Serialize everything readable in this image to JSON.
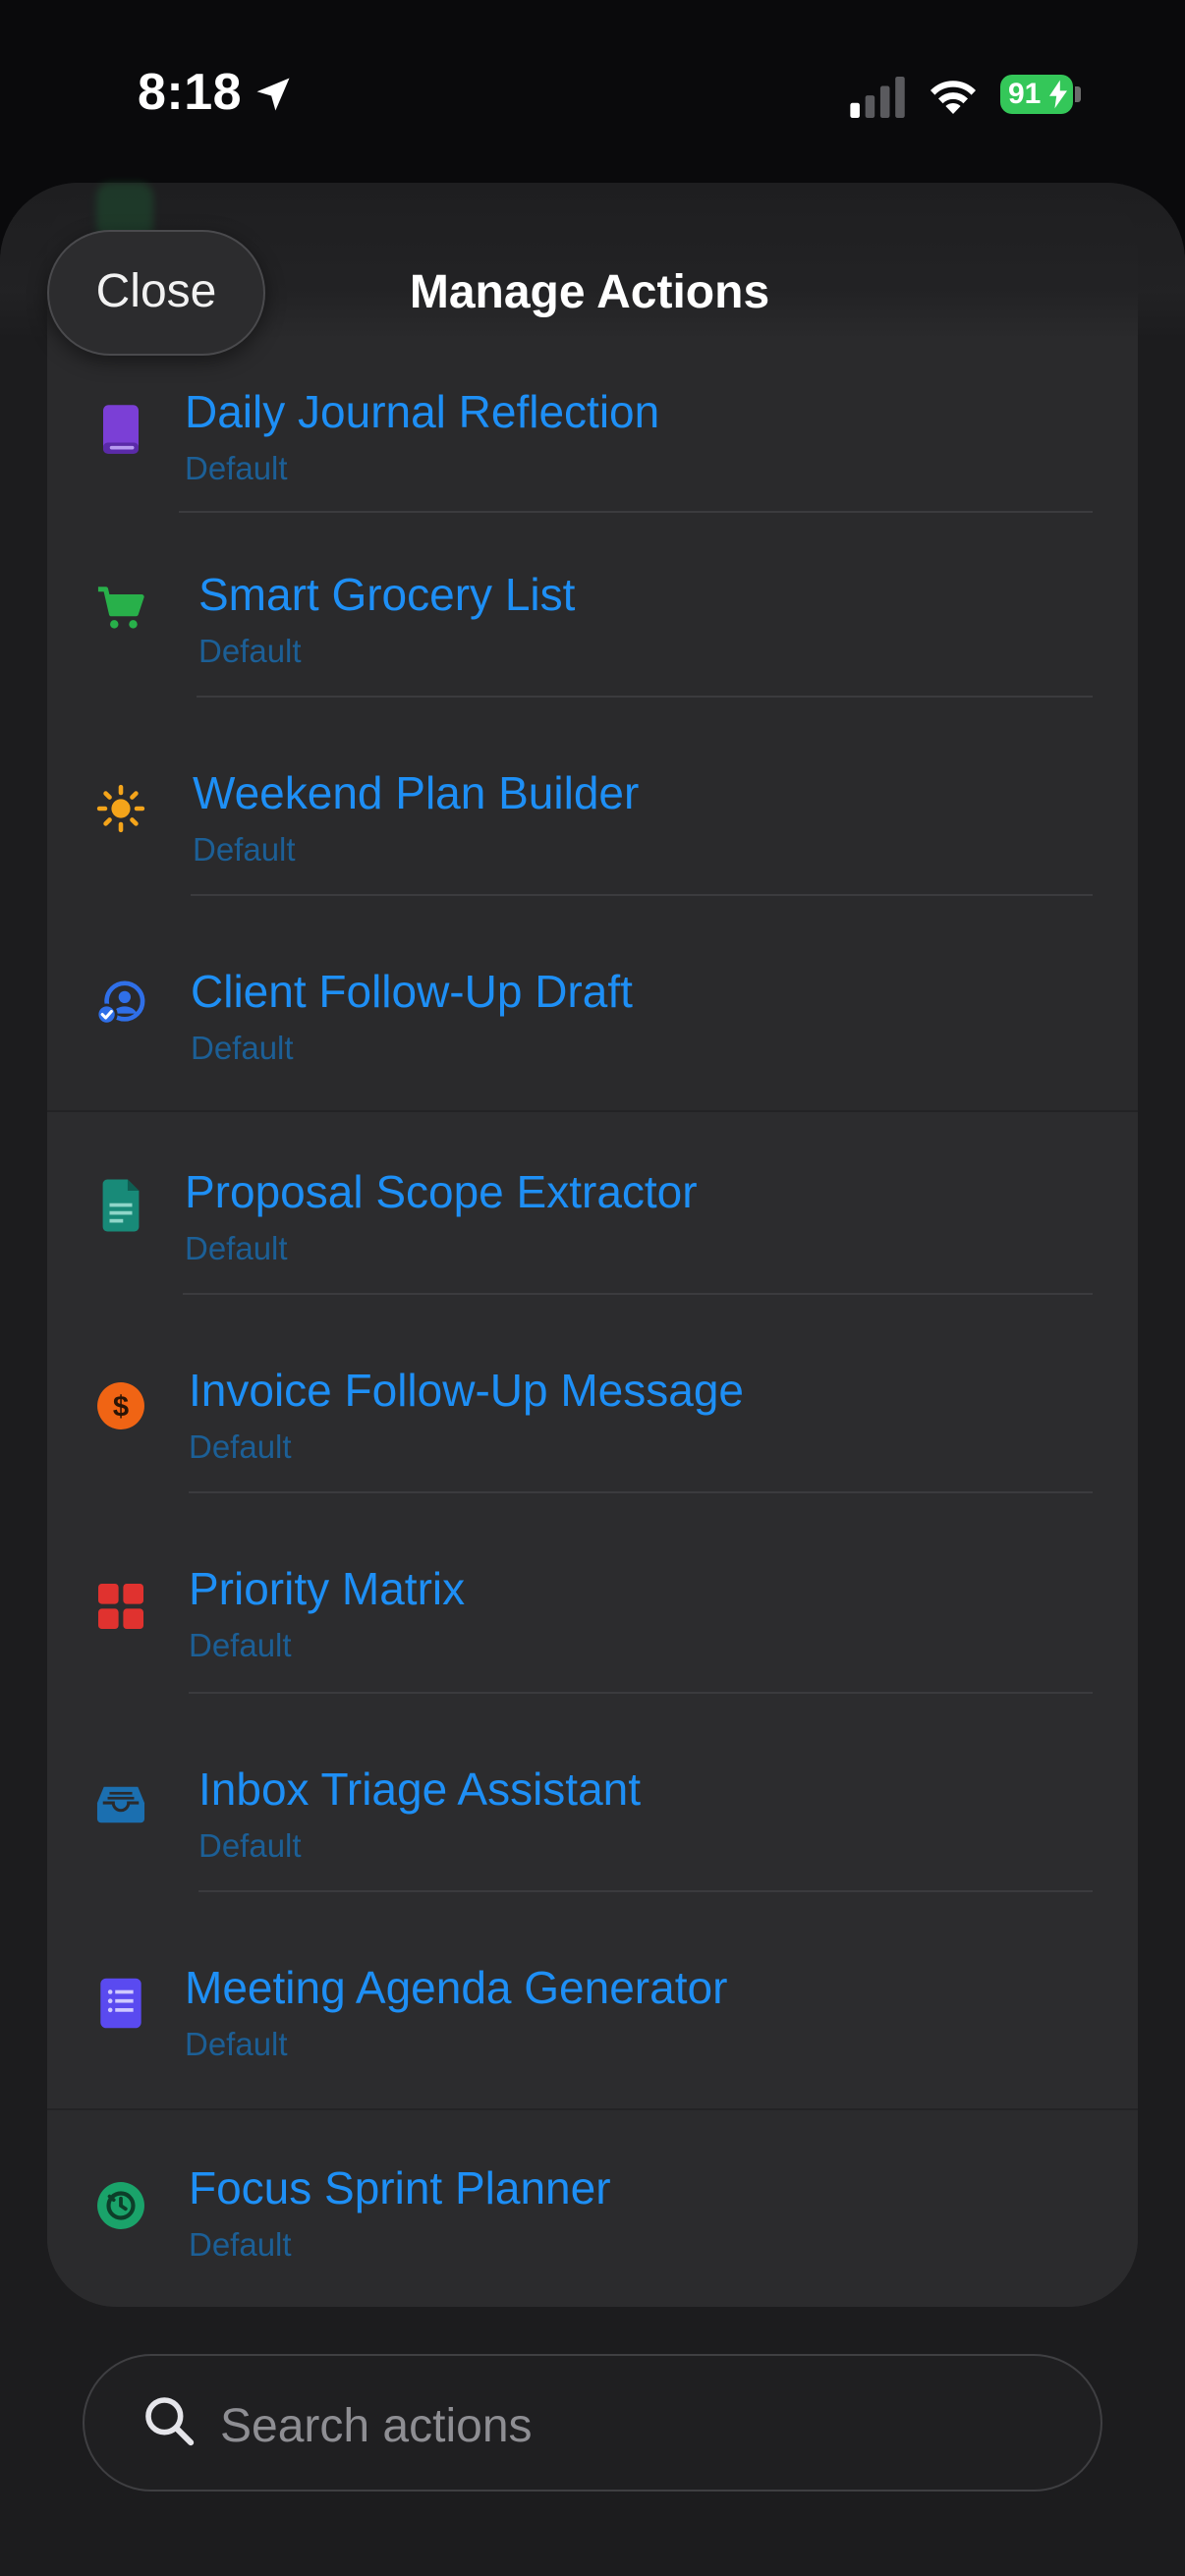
{
  "status_bar": {
    "time": "8:18",
    "battery": "91"
  },
  "header": {
    "close_label": "Close",
    "title": "Manage Actions"
  },
  "actions": [
    {
      "title": "Daily Journal Reflection",
      "subtitle": "Default",
      "icon": "book-icon",
      "color": "#7b3fd6"
    },
    {
      "title": "Smart Grocery List",
      "subtitle": "Default",
      "icon": "cart-icon",
      "color": "#28b04a"
    },
    {
      "title": "Weekend Plan Builder",
      "subtitle": "Default",
      "icon": "sun-icon",
      "color": "#f4a41a"
    },
    {
      "title": "Client Follow-Up Draft",
      "subtitle": "Default",
      "icon": "person-check-icon",
      "color": "#2f6fe8"
    },
    {
      "title": "Proposal Scope Extractor",
      "subtitle": "Default",
      "icon": "document-icon",
      "color": "#188a78"
    },
    {
      "title": "Invoice Follow-Up Message",
      "subtitle": "Default",
      "icon": "dollar-icon",
      "color": "#f06414"
    },
    {
      "title": "Priority Matrix",
      "subtitle": "Default",
      "icon": "grid-icon",
      "color": "#e0322f"
    },
    {
      "title": "Inbox Triage Assistant",
      "subtitle": "Default",
      "icon": "inbox-icon",
      "color": "#1b6fb0"
    },
    {
      "title": "Meeting Agenda Generator",
      "subtitle": "Default",
      "icon": "list-icon",
      "color": "#5a4af0"
    },
    {
      "title": "Focus Sprint Planner",
      "subtitle": "Default",
      "icon": "timer-icon",
      "color": "#1aa36a"
    }
  ],
  "search": {
    "placeholder": "Search actions"
  }
}
